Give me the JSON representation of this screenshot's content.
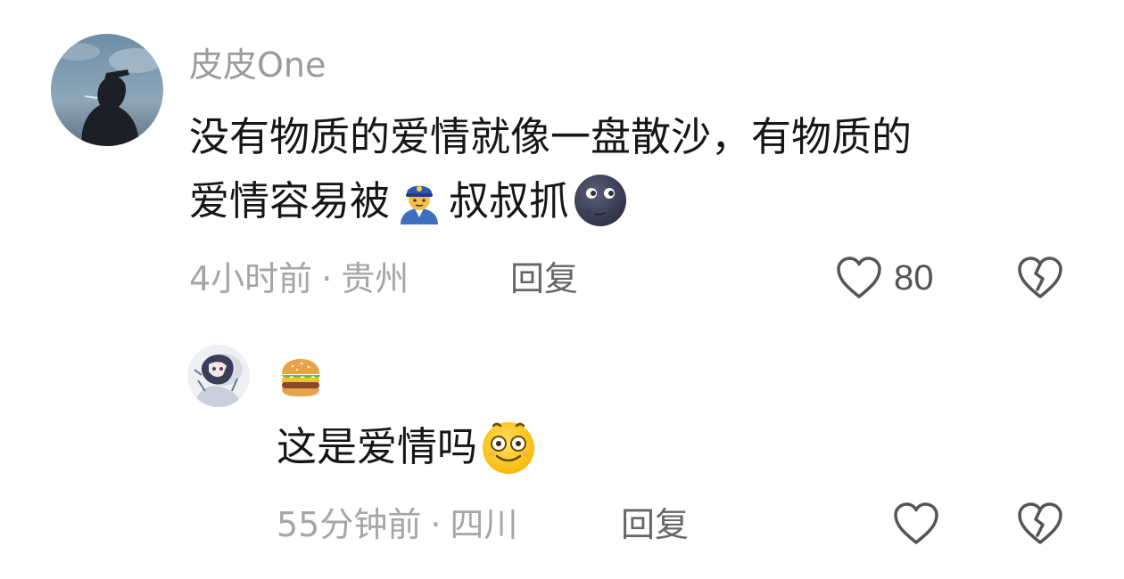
{
  "comments": [
    {
      "username": "皮皮One",
      "content": {
        "line1": "没有物质的爱情就像一盘散沙，有物质的",
        "line2_a": "爱情容易被",
        "line2_b": "叔叔抓"
      },
      "emojis": [
        "police-officer-emoji",
        "new-moon-face-emoji"
      ],
      "time": "4小时前",
      "separator": "·",
      "location": "贵州",
      "reply_label": "回复",
      "like_count": "80"
    },
    {
      "username_emoji": "hamburger-emoji",
      "content": {
        "text": "这是爱情吗"
      },
      "emojis": [
        "smiling-face-emoji"
      ],
      "time": "55分钟前",
      "separator": "·",
      "location": "四川",
      "reply_label": "回复",
      "like_count": ""
    }
  ],
  "icons": {
    "like": "heart-outline-icon",
    "dislike": "broken-heart-icon"
  },
  "colors": {
    "username": "#9b9b9b",
    "text": "#161616",
    "meta": "#a6a6a6",
    "icon": "#555555"
  }
}
